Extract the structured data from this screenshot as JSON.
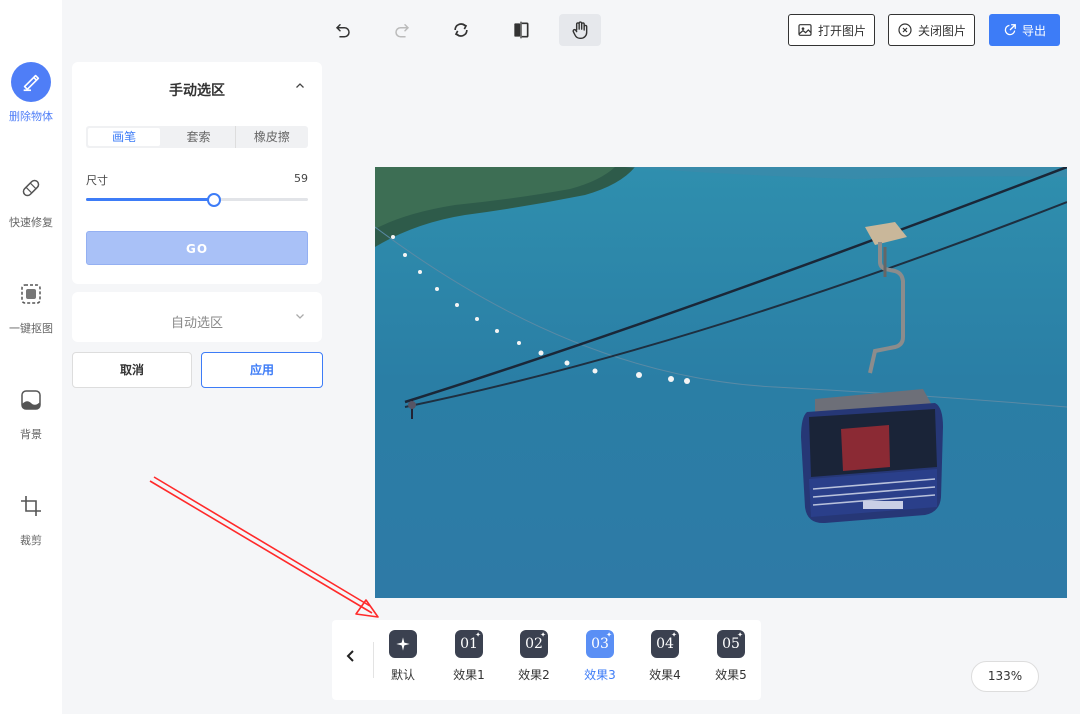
{
  "rail": [
    {
      "label": "删除物体",
      "icon": "eraser-icon",
      "active": true
    },
    {
      "label": "快速修复",
      "icon": "bandage-icon",
      "active": false
    },
    {
      "label": "一键抠图",
      "icon": "cutout-icon",
      "active": false
    },
    {
      "label": "背景",
      "icon": "background-icon",
      "active": false
    },
    {
      "label": "裁剪",
      "icon": "crop-icon",
      "active": false
    }
  ],
  "toolbar": {
    "open_label": "打开图片",
    "close_label": "关闭图片",
    "export_label": "导出"
  },
  "manual": {
    "title": "手动选区",
    "tabs": [
      "画笔",
      "套索",
      "橡皮擦"
    ],
    "active_tab": 0,
    "size_label": "尺寸",
    "size_value": "59",
    "slider_fraction": 0.575,
    "go_label": "GO"
  },
  "auto": {
    "title": "自动选区"
  },
  "actions": {
    "cancel": "取消",
    "apply": "应用"
  },
  "effects": {
    "items": [
      {
        "glyph": "",
        "label": "默认"
      },
      {
        "glyph": "01",
        "label": "效果1"
      },
      {
        "glyph": "02",
        "label": "效果2"
      },
      {
        "glyph": "03",
        "label": "效果3"
      },
      {
        "glyph": "04",
        "label": "效果4"
      },
      {
        "glyph": "05",
        "label": "效果5"
      }
    ],
    "active_index": 3
  },
  "zoom": "133%",
  "colors": {
    "accent": "#3d7cf7",
    "arrow": "#ff2a2a"
  }
}
